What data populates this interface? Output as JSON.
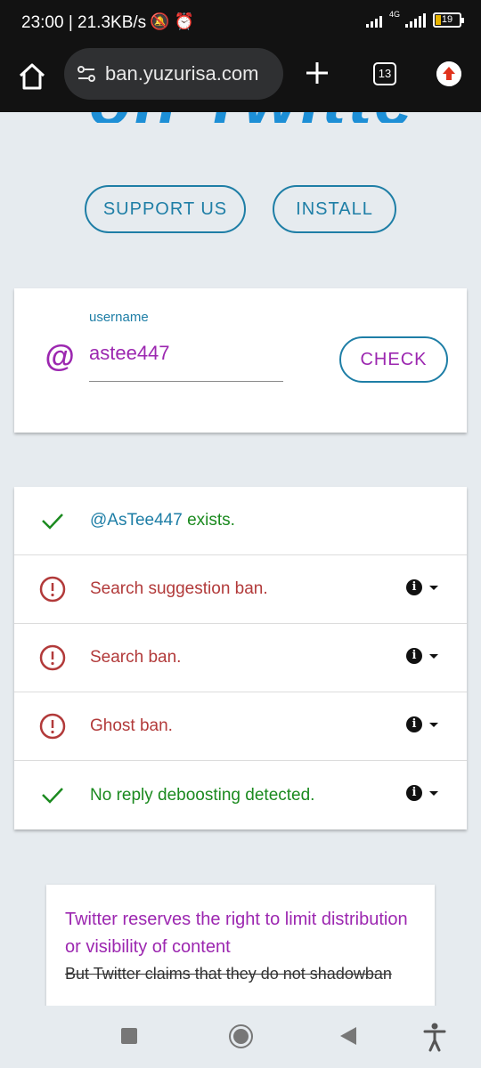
{
  "status_bar": {
    "time": "23:00",
    "speed": "21.3KB/s",
    "network_label": "4G",
    "battery": "19"
  },
  "browser": {
    "url": "ban.yuzurisa.com",
    "tab_count": "13"
  },
  "page": {
    "hero_fragment": "on Twitter?",
    "support_button": "SUPPORT US",
    "install_button": "INSTALL",
    "username_label": "username",
    "at_symbol": "@",
    "username_value": "astee447",
    "check_button": "CHECK"
  },
  "results": [
    {
      "status": "ok",
      "handle": "@AsTee447",
      "text": " exists.",
      "has_info": false
    },
    {
      "status": "bad",
      "text": "Search suggestion ban.",
      "has_info": true
    },
    {
      "status": "bad",
      "text": "Search ban.",
      "has_info": true
    },
    {
      "status": "bad",
      "text": "Ghost ban.",
      "has_info": true
    },
    {
      "status": "ok",
      "text": "No reply deboosting detected.",
      "has_info": true
    }
  ],
  "notice": {
    "main": "Twitter reserves the right to limit distribution or visibility of content",
    "strike": "But Twitter claims that they do not shadowban"
  },
  "colors": {
    "accent_blue": "#1e7ea6",
    "purple": "#9c27b0",
    "ok_green": "#1b8a1f",
    "bad_red": "#b23a3a"
  }
}
